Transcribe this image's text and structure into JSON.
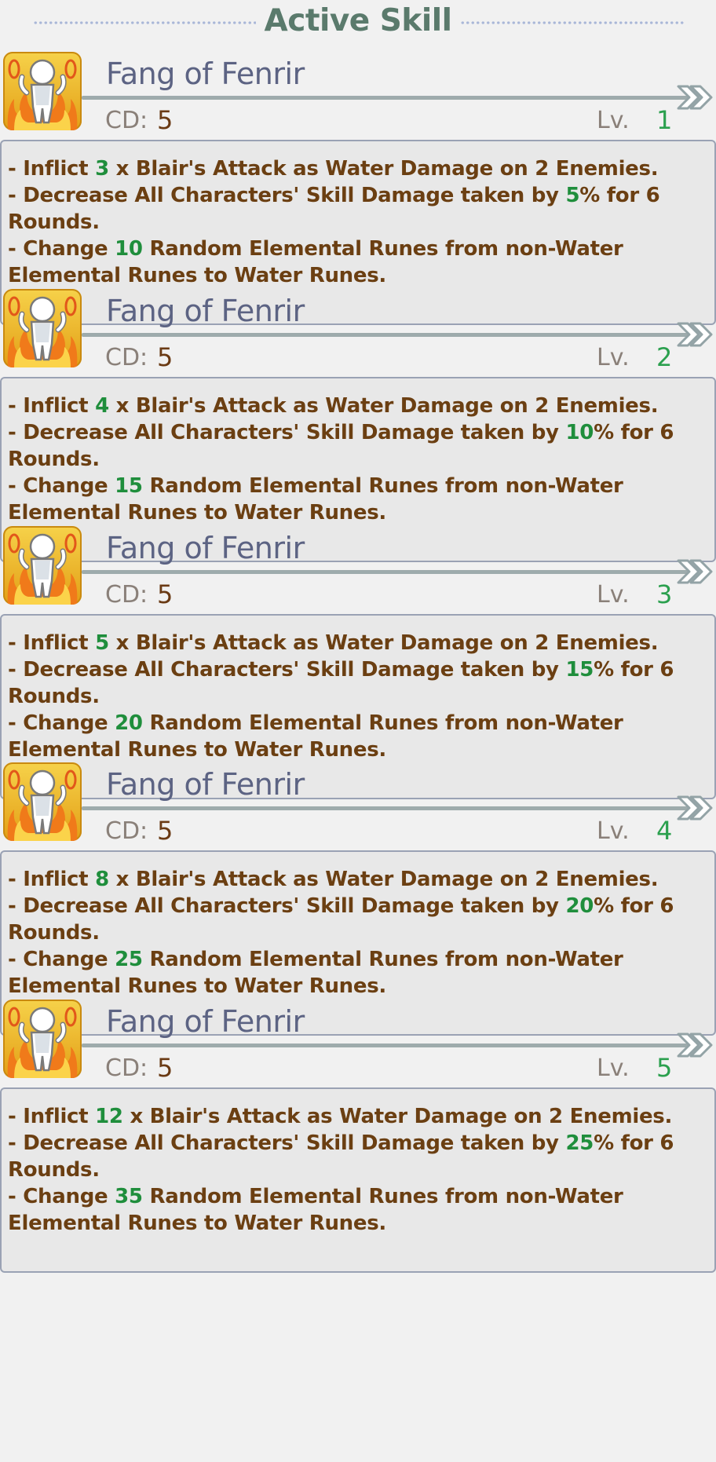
{
  "header": {
    "title": "Active Skill"
  },
  "skills": [
    {
      "name": "Fang of Fenrir",
      "cd_label": "CD:",
      "cd": "5",
      "lv_label": "Lv.",
      "lv": "1",
      "line1": {
        "pre": "- Inflict",
        "hit": "3",
        "post": "x Blair's Attack as Water Damage on 2 Enemies."
      },
      "line2": {
        "pre": "- Decrease All Characters' Skill Damage taken by",
        "pct": "5",
        "post": "% for 6 Rounds."
      },
      "line3": {
        "pre": "- Change",
        "runes": "10",
        "post": "Random Elemental Runes from non-Water Elemental Runes to Water Runes."
      }
    },
    {
      "name": "Fang of Fenrir",
      "cd_label": "CD:",
      "cd": "5",
      "lv_label": "Lv.",
      "lv": "2",
      "line1": {
        "pre": "- Inflict",
        "hit": "4",
        "post": "x Blair's Attack as Water Damage on 2 Enemies."
      },
      "line2": {
        "pre": "- Decrease All Characters' Skill Damage taken by",
        "pct": "10",
        "post": "% for 6 Rounds."
      },
      "line3": {
        "pre": "- Change",
        "runes": "15",
        "post": "Random Elemental Runes from non-Water Elemental Runes to Water Runes."
      }
    },
    {
      "name": "Fang of Fenrir",
      "cd_label": "CD:",
      "cd": "5",
      "lv_label": "Lv.",
      "lv": "3",
      "line1": {
        "pre": "- Inflict",
        "hit": "5",
        "post": "x Blair's Attack as Water Damage on 2 Enemies."
      },
      "line2": {
        "pre": "- Decrease All Characters' Skill Damage taken by",
        "pct": "15",
        "post": "% for 6 Rounds."
      },
      "line3": {
        "pre": "- Change",
        "runes": "20",
        "post": "Random Elemental Runes from non-Water Elemental Runes to Water Runes."
      }
    },
    {
      "name": "Fang of Fenrir",
      "cd_label": "CD:",
      "cd": "5",
      "lv_label": "Lv.",
      "lv": "4",
      "line1": {
        "pre": "- Inflict",
        "hit": "8",
        "post": "x Blair's Attack as Water Damage on 2 Enemies."
      },
      "line2": {
        "pre": "- Decrease All Characters' Skill Damage taken by",
        "pct": "20",
        "post": "% for 6 Rounds."
      },
      "line3": {
        "pre": "- Change",
        "runes": "25",
        "post": "Random Elemental Runes from non-Water Elemental Runes to Water Runes."
      }
    },
    {
      "name": "Fang of Fenrir",
      "cd_label": "CD:",
      "cd": "5",
      "lv_label": "Lv.",
      "lv": "5",
      "line1": {
        "pre": "- Inflict",
        "hit": "12",
        "post": "x Blair's Attack as Water Damage on 2 Enemies."
      },
      "line2": {
        "pre": "- Decrease All Characters' Skill Damage taken by",
        "pct": "25",
        "post": "% for 6 Rounds."
      },
      "line3": {
        "pre": "- Change",
        "runes": "35",
        "post": "Random Elemental Runes from non-Water Elemental Runes to Water Runes."
      }
    }
  ],
  "icons": {
    "skill_icon": "flame-figure-icon",
    "expand_icon": "double-chevron-right-icon"
  },
  "colors": {
    "highlight": "#1f8e3c",
    "text": "#6b3f12",
    "title": "#5a7a6c",
    "skill_name": "#5c6383"
  }
}
